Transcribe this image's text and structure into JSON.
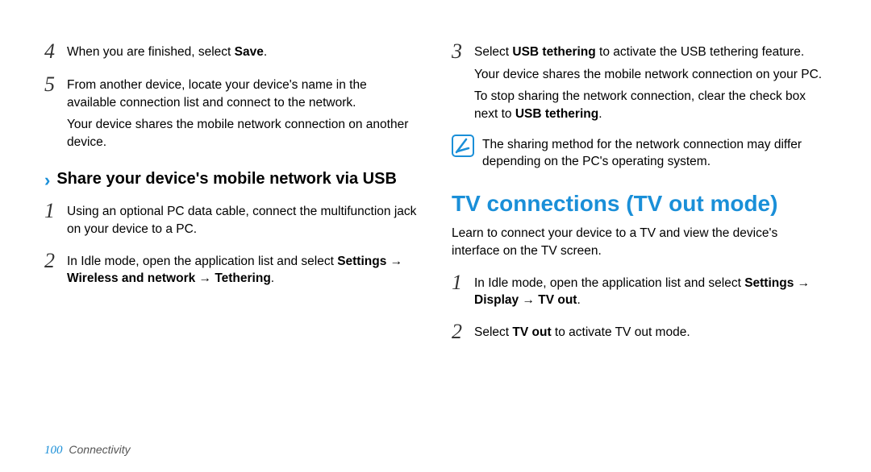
{
  "left": {
    "step4_num": "4",
    "step4_text_pre": "When you are finished, select ",
    "step4_bold": "Save",
    "step4_text_post": ".",
    "step5_num": "5",
    "step5_p1": "From another device, locate your device's name in the available connection list and connect to the network.",
    "step5_p2": "Your device shares the mobile network connection on another device.",
    "sec_title": "Share your device's mobile network via USB",
    "u1_num": "1",
    "u1_text": "Using an optional PC data cable, connect the multifunction jack on your device to a PC.",
    "u2_num": "2",
    "u2_pre": "In Idle mode, open the application list and select ",
    "u2_bold": "Settings → Wireless and network → Tethering",
    "u2_post": "."
  },
  "right": {
    "r3_num": "3",
    "r3_p1_pre": "Select ",
    "r3_p1_bold": "USB tethering",
    "r3_p1_post": " to activate the USB tethering feature.",
    "r3_p2": "Your device shares the mobile network connection on your PC.",
    "r3_p3_pre": "To stop sharing the network connection, clear the check box next to ",
    "r3_p3_bold": "USB tethering",
    "r3_p3_post": ".",
    "note_text": "The sharing method for the network connection may differ depending on the PC's operating system.",
    "heading": "TV connections (TV out mode)",
    "intro": "Learn to connect your device to a TV and view the device's interface on the TV screen.",
    "t1_num": "1",
    "t1_pre": "In Idle mode, open the application list and select ",
    "t1_bold": "Settings → Display → TV out",
    "t1_post": ".",
    "t2_num": "2",
    "t2_pre": "Select ",
    "t2_bold": "TV out",
    "t2_post": " to activate TV out mode."
  },
  "footer": {
    "page": "100",
    "section": "Connectivity"
  }
}
